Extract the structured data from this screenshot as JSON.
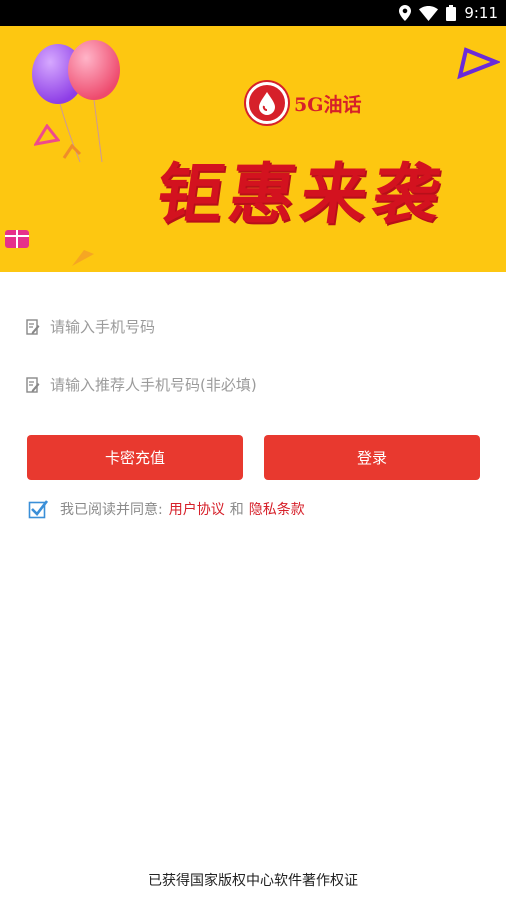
{
  "status_bar": {
    "time": "9:11",
    "icons": [
      "location-icon",
      "wifi-icon",
      "battery-icon"
    ]
  },
  "banner": {
    "brand_name": "5G油话",
    "headline": "钜惠来袭",
    "background_color": "#fdc711",
    "accent_color": "#d6202a"
  },
  "form": {
    "phone": {
      "placeholder": "请输入手机号码",
      "value": ""
    },
    "referrer": {
      "placeholder": "请输入推荐人手机号码(非必填)",
      "value": ""
    }
  },
  "buttons": {
    "card_recharge": "卡密充值",
    "login": "登录",
    "color": "#e8392f"
  },
  "agreement": {
    "checked": true,
    "text": "我已阅读并同意:",
    "user_agreement": "用户协议",
    "and": "和",
    "privacy_policy": "隐私条款"
  },
  "footer": {
    "text": "已获得国家版权中心软件著作权证"
  }
}
